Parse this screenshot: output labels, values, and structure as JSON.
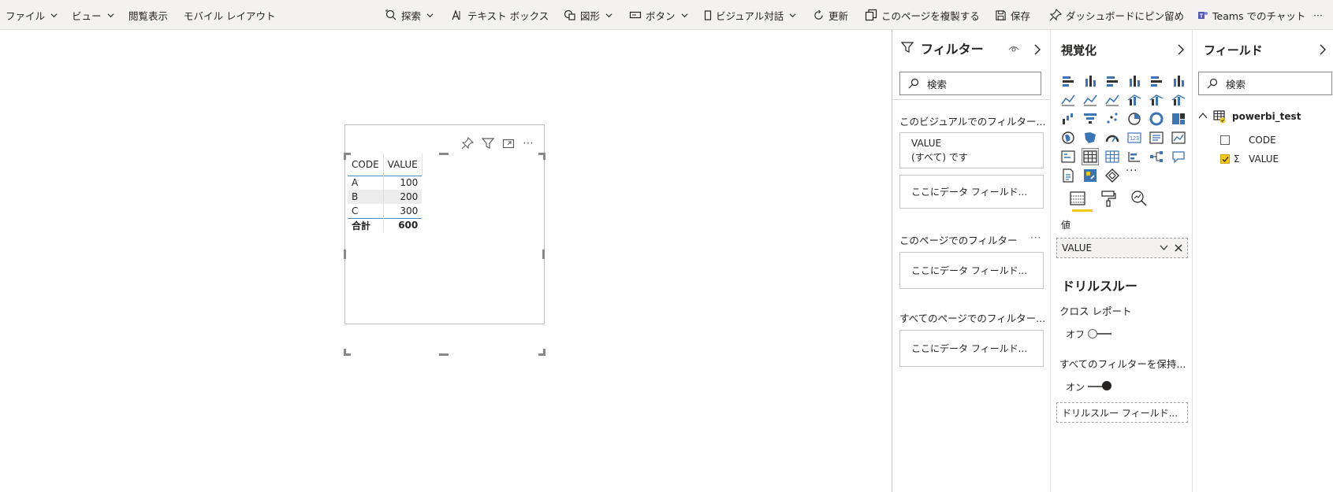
{
  "toolbar": {
    "file": "ファイル",
    "view": "ビュー",
    "reading_view": "閲覧表示",
    "mobile_layout": "モバイル レイアウト",
    "explore": "探索",
    "text_box": "テキスト ボックス",
    "shapes": "図形",
    "buttons": "ボタン",
    "visual_qa": "ビジュアル対話",
    "refresh": "更新",
    "duplicate_page": "このページを複製する",
    "save": "保存",
    "pin_dashboard": "ダッシュボードにピン留め",
    "teams_chat": "Teams でのチャット",
    "more": "···"
  },
  "table_visual": {
    "columns": [
      "CODE",
      "VALUE"
    ],
    "rows": [
      {
        "code": "A",
        "value": "100"
      },
      {
        "code": "B",
        "value": "200"
      },
      {
        "code": "C",
        "value": "300"
      }
    ],
    "total_label": "合計",
    "total_value": "600",
    "header_icons": [
      "pin-icon",
      "filter-icon",
      "focus-mode-icon",
      "more-options-icon"
    ],
    "more": "⋯"
  },
  "filters_pane": {
    "title": "フィルター",
    "search_placeholder": "検索",
    "visual_filters_label": "このビジュアルでのフィルター...",
    "visual_filter_card": {
      "field": "VALUE",
      "state": "(すべて) です"
    },
    "add_field_placeholder": "ここにデータ フィールド...",
    "page_filters_label": "このページでのフィルター",
    "page_more": "···",
    "all_pages_label": "すべてのページでのフィルター..."
  },
  "visualizations_pane": {
    "title": "視覚化",
    "more_visuals": "···",
    "values_label": "値",
    "values_well_field": "VALUE",
    "drillthrough_title": "ドリルスルー",
    "cross_report_label": "クロス レポート",
    "cross_report_state": "オフ",
    "keep_filters_label": "すべてのフィルターを保持...",
    "keep_filters_state": "オン",
    "drillthrough_well": "ドリルスルー フィールド..."
  },
  "fields_pane": {
    "title": "フィールド",
    "search_placeholder": "検索",
    "table_name": "powerbi_test",
    "fields": [
      {
        "name": "CODE",
        "checked": false,
        "sigma": false
      },
      {
        "name": "VALUE",
        "checked": true,
        "sigma": true
      }
    ]
  },
  "colors": {
    "accent": "#f2c811",
    "viz_icon": "#3a75b8",
    "table_header_rule": "#4a90c8"
  }
}
